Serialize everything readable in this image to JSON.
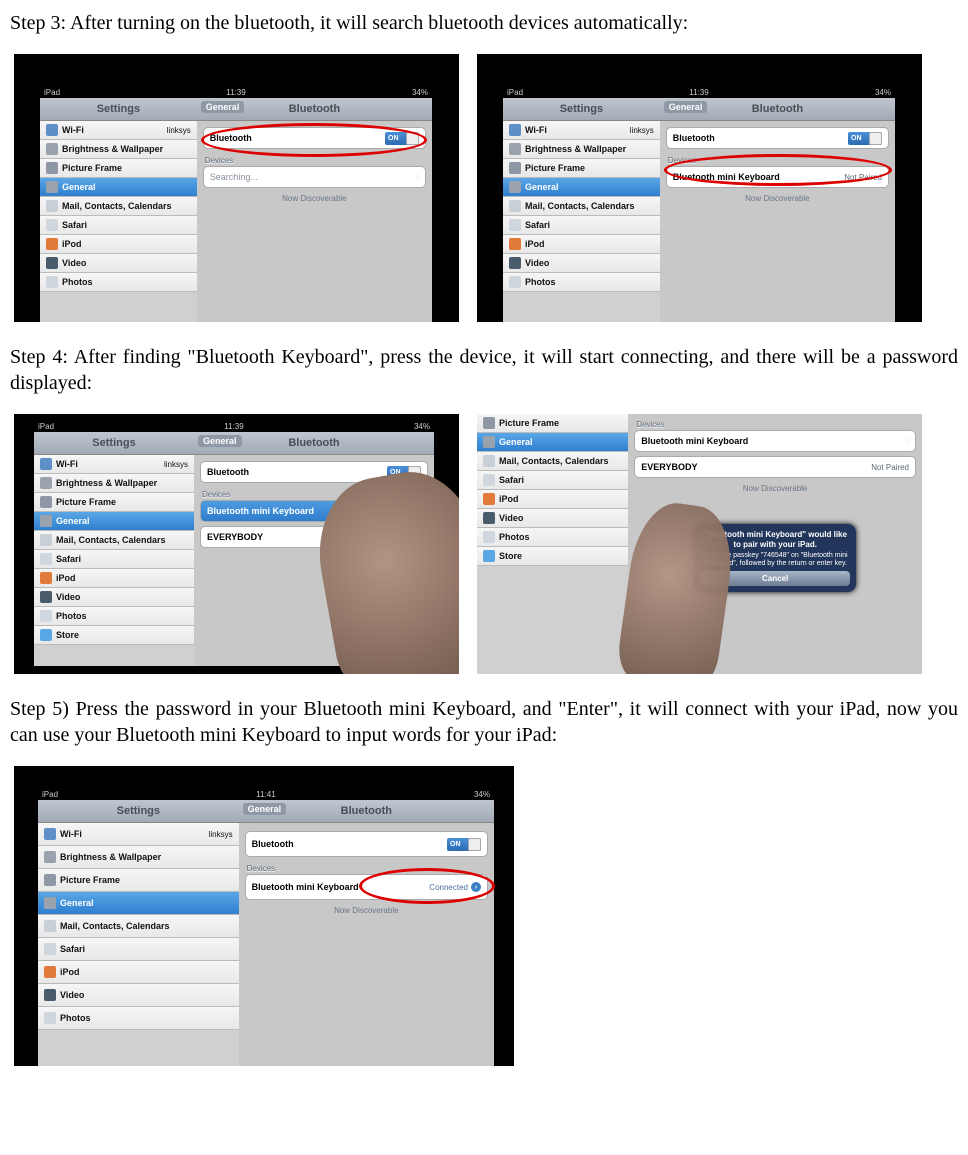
{
  "steps": {
    "s3": "Step 3: After turning on the bluetooth, it will search bluetooth devices automatically:",
    "s4": "Step 4: After finding \"Bluetooth Keyboard\", press the device, it will start connecting, and there will be a password displayed:",
    "s5": "Step 5) Press the password in your Bluetooth mini Keyboard, and \"Enter\", it will connect with your iPad, now you can use your Bluetooth mini Keyboard to input words for your iPad:"
  },
  "status": {
    "left": "iPad",
    "time1": "11:39",
    "time2": "11:39",
    "time5": "11:41",
    "right1": "34%",
    "right5": "34%"
  },
  "headers": {
    "settings": "Settings",
    "bluetooth": "Bluetooth",
    "general_back": "General"
  },
  "sidebar": {
    "wifi": "Wi-Fi",
    "wifi_val": "linksys",
    "brightness": "Brightness & Wallpaper",
    "picture": "Picture Frame",
    "general": "General",
    "mail": "Mail, Contacts, Calendars",
    "safari": "Safari",
    "ipod": "iPod",
    "video": "Video",
    "photos": "Photos",
    "store": "Store"
  },
  "main": {
    "bt_label": "Bluetooth",
    "on": "ON",
    "devices": "Devices",
    "searching": "Searching...",
    "discover": "Now Discoverable",
    "device_name": "Bluetooth mini Keyboard",
    "not_paired": "Not Paired",
    "everybody": "EVERYBODY",
    "connected": "Connected"
  },
  "dialog": {
    "title": "\"Bluetooth mini Keyboard\" would like to pair with your iPad.",
    "msg": "Enter the passkey \"746548\" on \"Bluetooth mini Keyboard\", followed by the return or enter key.",
    "cancel": "Cancel"
  }
}
